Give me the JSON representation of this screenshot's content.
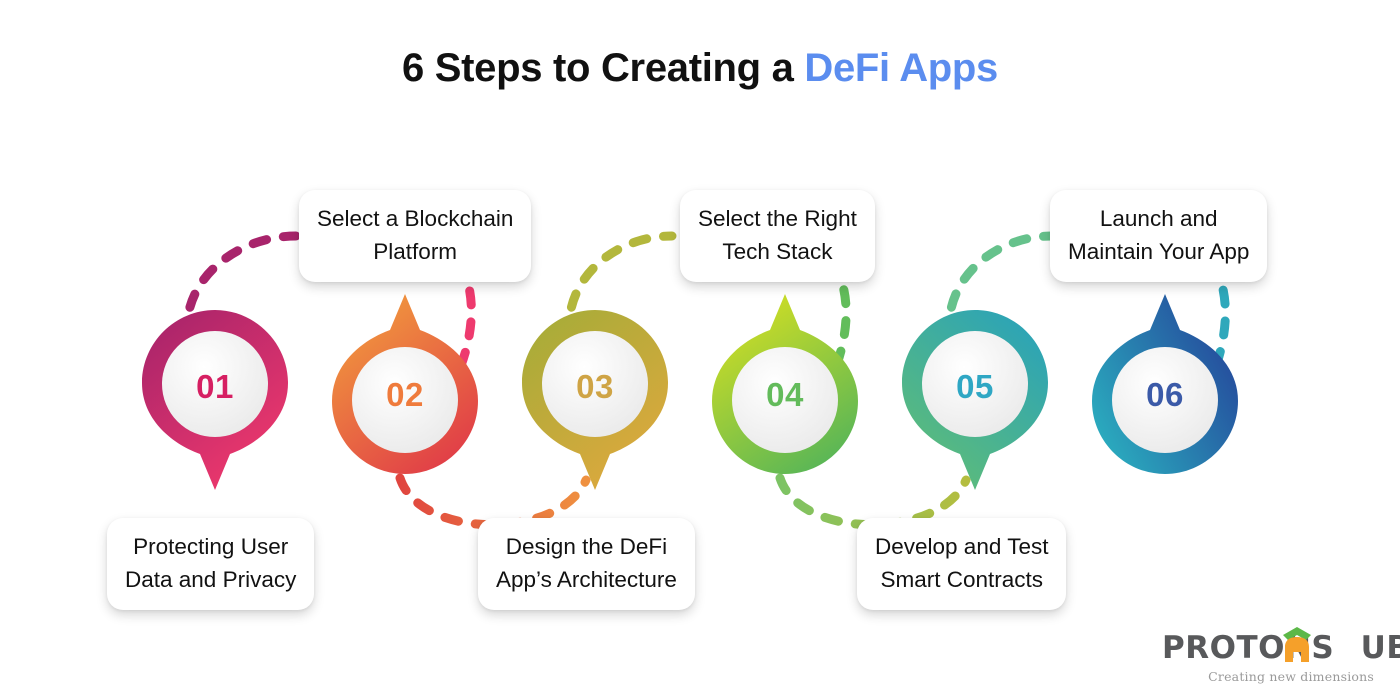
{
  "title": {
    "lead": "6 Steps to Creating a ",
    "accent": "DeFi Apps",
    "accent_color": "#5b8def",
    "lead_color": "#111111"
  },
  "steps": [
    {
      "number": "01",
      "label_line1": "Protecting User",
      "label_line2": "Data and Privacy",
      "label_position": "bottom",
      "pin_direction": "down",
      "color_from": "#a8246b",
      "color_to": "#f2396c",
      "number_color": "#d61f62"
    },
    {
      "number": "02",
      "label_line1": "Select a Blockchain",
      "label_line2": "Platform",
      "label_position": "top",
      "pin_direction": "up",
      "color_from": "#f2a03c",
      "color_to": "#e03a48",
      "number_color": "#ef7b3c"
    },
    {
      "number": "03",
      "label_line1": "Design the DeFi",
      "label_line2": "App’s Architecture",
      "label_position": "bottom",
      "pin_direction": "down",
      "color_from": "#a6ac38",
      "color_to": "#e0a83e",
      "number_color": "#cfa445"
    },
    {
      "number": "04",
      "label_line1": "Select the Right",
      "label_line2": "Tech Stack",
      "label_position": "top",
      "pin_direction": "up",
      "color_from": "#d7e021",
      "color_to": "#56b558",
      "number_color": "#63bb5b"
    },
    {
      "number": "05",
      "label_line1": "Develop and Test",
      "label_line2": "Smart Contracts",
      "label_position": "bottom",
      "pin_direction": "down",
      "color_from": "#2ba3b8",
      "color_to": "#63bf72",
      "number_color": "#2fa7c4"
    },
    {
      "number": "06",
      "label_line1": "Launch and",
      "label_line2": "Maintain Your App",
      "label_position": "top",
      "pin_direction": "up",
      "color_from": "#2aa8bd",
      "color_to": "#25449a",
      "number_color": "#3b5aa8"
    }
  ],
  "connectors": [
    {
      "name": "connector-01-up",
      "color": "#a8246b"
    },
    {
      "name": "connector-02-down",
      "color": "#ee3a6e"
    },
    {
      "name": "connector-02-03",
      "color_from": "#e0453f",
      "color_to": "#ef9140"
    },
    {
      "name": "connector-03-up",
      "color": "#b3b73c"
    },
    {
      "name": "connector-04-down",
      "color": "#62bd5b"
    },
    {
      "name": "connector-04-05",
      "color_from": "#7cc364",
      "color_to": "#b4bd3f"
    },
    {
      "name": "connector-05-up",
      "color": "#66c28c"
    },
    {
      "name": "connector-06-down",
      "color": "#2fa8bb"
    }
  ],
  "logo": {
    "word": "PROTONSHUB",
    "word_pre": "PROTONS",
    "word_post": "UB",
    "tagline": "Creating new dimensions",
    "word_color": "#58595b",
    "house_color": "#f5a02a",
    "roof_color": "#5cb848",
    "tagline_color": "#9a9a9a"
  }
}
